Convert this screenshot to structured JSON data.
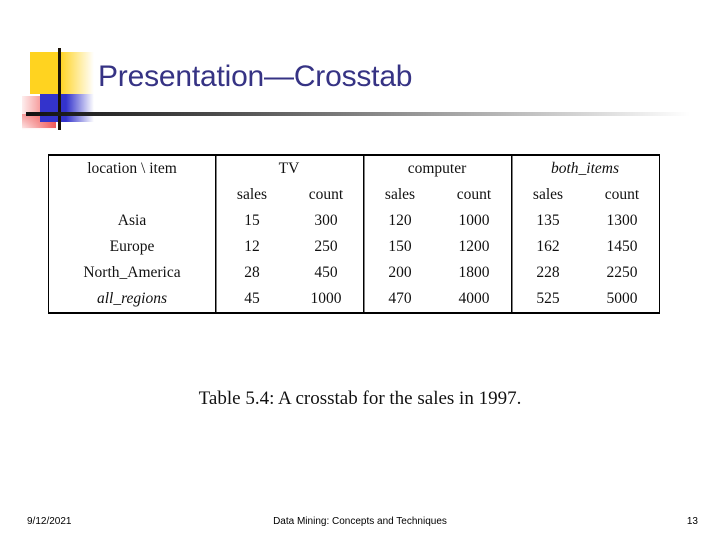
{
  "slide": {
    "title": "Presentation—Crosstab",
    "title_color": "#363384"
  },
  "figure": {
    "caption": "Table 5.4: A crosstab for the sales in 1997.",
    "corner_header": "location \\ item",
    "sub_headers": {
      "sales": "sales",
      "count": "count"
    },
    "groups": [
      {
        "label": "TV",
        "italic": false
      },
      {
        "label": "computer",
        "italic": false
      },
      {
        "label": "both_items",
        "italic": true
      }
    ],
    "rows": [
      {
        "location": "Asia",
        "italic": false,
        "tv_sales": "15",
        "tv_count": "300",
        "computer_sales": "120",
        "computer_count": "1000",
        "both_sales": "135",
        "both_count": "1300"
      },
      {
        "location": "Europe",
        "italic": false,
        "tv_sales": "12",
        "tv_count": "250",
        "computer_sales": "150",
        "computer_count": "1200",
        "both_sales": "162",
        "both_count": "1450"
      },
      {
        "location": "North_America",
        "italic": false,
        "tv_sales": "28",
        "tv_count": "450",
        "computer_sales": "200",
        "computer_count": "1800",
        "both_sales": "228",
        "both_count": "2250"
      }
    ],
    "total_row": {
      "location": "all_regions",
      "italic": true,
      "tv_sales": "45",
      "tv_count": "1000",
      "computer_sales": "470",
      "computer_count": "4000",
      "both_sales": "525",
      "both_count": "5000"
    }
  },
  "chart_data": {
    "type": "table",
    "title": "Table 5.4: A crosstab for the sales in 1997.",
    "row_dimension": "location",
    "column_dimension": "item",
    "column_groups": [
      "TV",
      "computer",
      "both_items"
    ],
    "measures": [
      "sales",
      "count"
    ],
    "categories": [
      "Asia",
      "Europe",
      "North_America",
      "all_regions"
    ],
    "series": [
      {
        "name": "TV sales",
        "values": [
          15,
          12,
          28,
          45
        ]
      },
      {
        "name": "TV count",
        "values": [
          300,
          250,
          450,
          1000
        ]
      },
      {
        "name": "computer sales",
        "values": [
          120,
          150,
          200,
          470
        ]
      },
      {
        "name": "computer count",
        "values": [
          1000,
          1200,
          1800,
          4000
        ]
      },
      {
        "name": "both_items sales",
        "values": [
          135,
          162,
          228,
          525
        ]
      },
      {
        "name": "both_items count",
        "values": [
          1300,
          1450,
          2250,
          5000
        ]
      }
    ]
  },
  "footer": {
    "date": "9/12/2021",
    "center": "Data Mining: Concepts and Techniques",
    "page": "13"
  }
}
